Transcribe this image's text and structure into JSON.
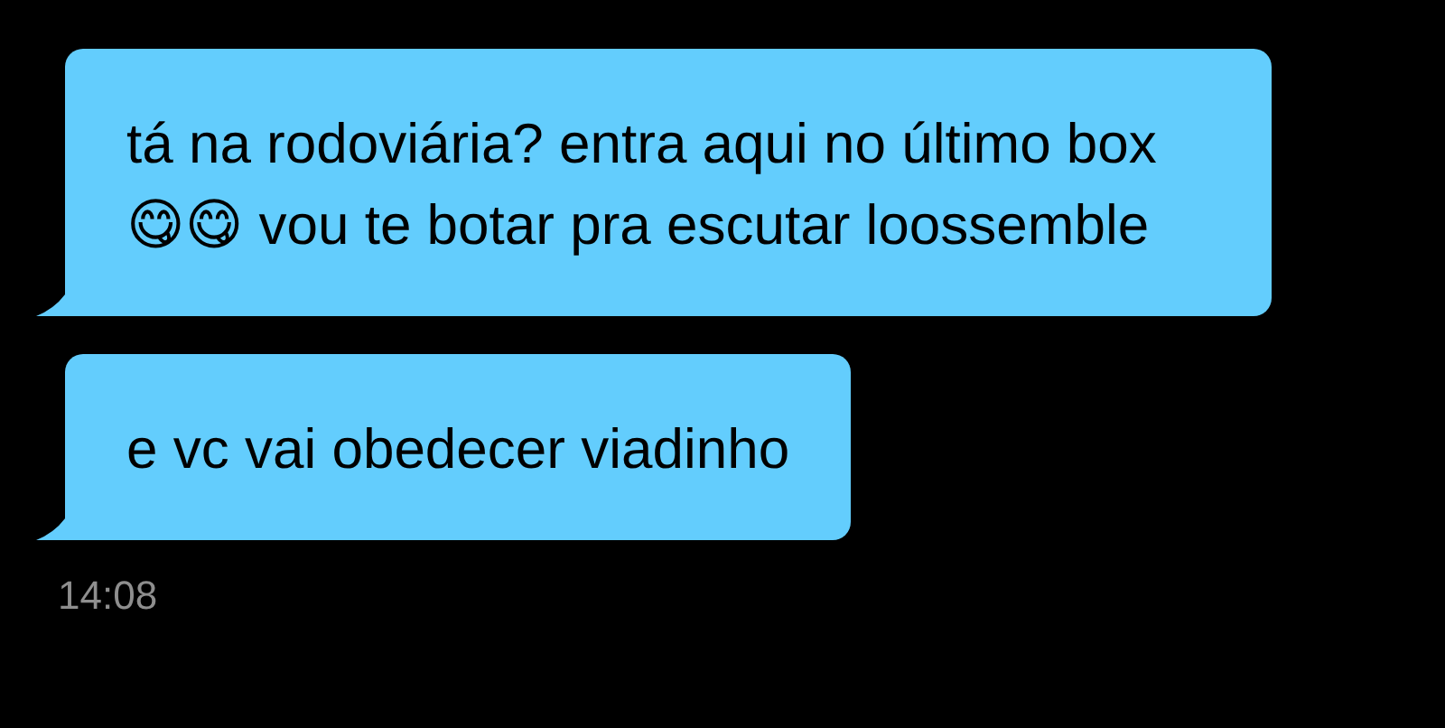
{
  "messages": [
    {
      "text": "tá na rodoviária? entra aqui no último box 😋😋 vou te botar pra escutar loossemble"
    },
    {
      "text": "e vc vai obedecer viadinho"
    }
  ],
  "time": "14:08"
}
